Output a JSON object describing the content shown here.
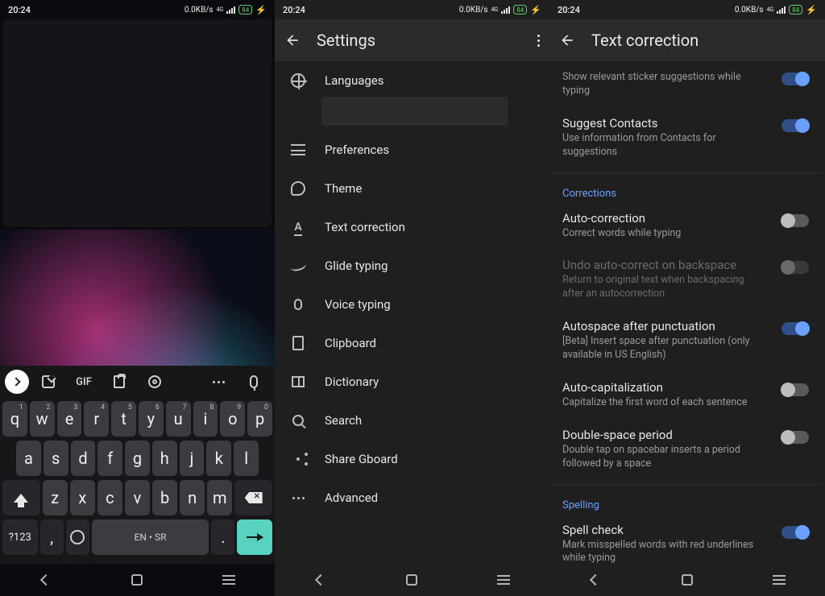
{
  "status": {
    "time": "20:24",
    "net": "0.0KB/s",
    "netGen": "4G",
    "battery": "84"
  },
  "keyboard": {
    "toolbar": {
      "gif": "GIF"
    },
    "row1": [
      {
        "k": "q",
        "s": "1"
      },
      {
        "k": "w",
        "s": "2"
      },
      {
        "k": "e",
        "s": "3"
      },
      {
        "k": "r",
        "s": "4"
      },
      {
        "k": "t",
        "s": "5"
      },
      {
        "k": "y",
        "s": "6"
      },
      {
        "k": "u",
        "s": "7"
      },
      {
        "k": "i",
        "s": "8"
      },
      {
        "k": "o",
        "s": "9"
      },
      {
        "k": "p",
        "s": "0"
      }
    ],
    "row2": [
      "a",
      "s",
      "d",
      "f",
      "g",
      "h",
      "j",
      "k",
      "l"
    ],
    "row3": [
      "z",
      "x",
      "c",
      "v",
      "b",
      "n",
      "m"
    ],
    "symKey": "?123",
    "comma": ",",
    "period": ".",
    "space": "EN • SR"
  },
  "settings": {
    "title": "Settings",
    "items": [
      {
        "label": "Languages"
      },
      {
        "label": "Preferences"
      },
      {
        "label": "Theme"
      },
      {
        "label": "Text correction"
      },
      {
        "label": "Glide typing"
      },
      {
        "label": "Voice typing"
      },
      {
        "label": "Clipboard"
      },
      {
        "label": "Dictionary"
      },
      {
        "label": "Search"
      },
      {
        "label": "Share Gboard"
      },
      {
        "label": "Advanced"
      }
    ]
  },
  "textcorr": {
    "title": "Text correction",
    "topItem": {
      "title": "",
      "sub": "Show relevant sticker suggestions while typing"
    },
    "contacts": {
      "title": "Suggest Contacts",
      "sub": "Use information from Contacts for suggestions"
    },
    "sections": {
      "corrections": "Corrections",
      "spelling": "Spelling"
    },
    "auto": {
      "title": "Auto-correction",
      "sub": "Correct words while typing"
    },
    "undo": {
      "title": "Undo auto-correct on backspace",
      "sub": "Return to original text when backspacing after an autocorrection"
    },
    "autospace": {
      "title": "Autospace after punctuation",
      "sub": "[Beta] Insert space after punctuation (only available in US English)"
    },
    "autocap": {
      "title": "Auto-capitalization",
      "sub": "Capitalize the first word of each sentence"
    },
    "dblspace": {
      "title": "Double-space period",
      "sub": "Double tap on spacebar inserts a period followed by a space"
    },
    "spell": {
      "title": "Spell check",
      "sub": "Mark misspelled words with red underlines while typing"
    }
  }
}
